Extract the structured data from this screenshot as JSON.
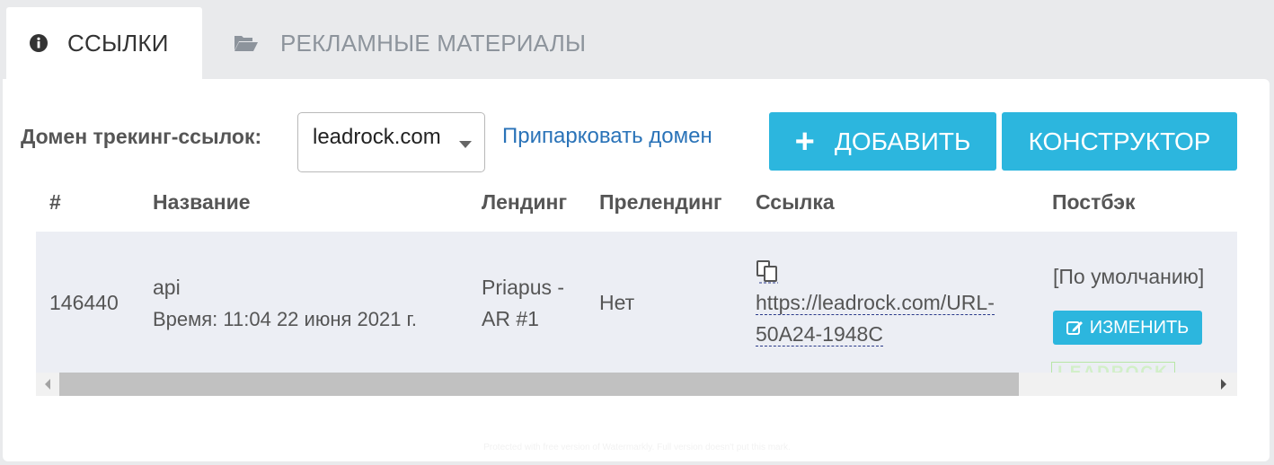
{
  "tabs": {
    "links": {
      "label": "ССЫЛКИ",
      "icon": "info-circle-icon"
    },
    "materials": {
      "label": "РЕКЛАМНЫЕ МАТЕРИАЛЫ",
      "icon": "folder-open-icon"
    }
  },
  "domain": {
    "label": "Домен трекинг-ссылок:",
    "selected": "leadrock.com",
    "park_link": "Припарковать домен"
  },
  "toolbar": {
    "add_label": "ДОБАВИТЬ",
    "constructor_label": "КОНСТРУКТОР"
  },
  "table": {
    "headers": {
      "id": "#",
      "name": "Название",
      "landing": "Лендинг",
      "prelanding": "Прелендинг",
      "link": "Ссылка",
      "postback": "Постбэк"
    },
    "rows": [
      {
        "id": "146440",
        "name": "api",
        "time": "Время: 11:04 22 июня 2021 г.",
        "landing_line1": "Priapus -",
        "landing_line2": "AR #1",
        "prelanding": "Нет",
        "link_line1": "https://leadrock.com/URL-",
        "link_line2": "50A24-1948C",
        "postback": "[По умолчанию]",
        "edit_label": "ИЗМЕНИТЬ"
      }
    ]
  },
  "brand_mark": "LEADROCK",
  "watermark": "Protected with free version of Watermarkly. Full version doesn't put this mark.",
  "colors": {
    "accent": "#2cb6de",
    "link": "#2a73b8",
    "row_bg": "#eceef4"
  }
}
